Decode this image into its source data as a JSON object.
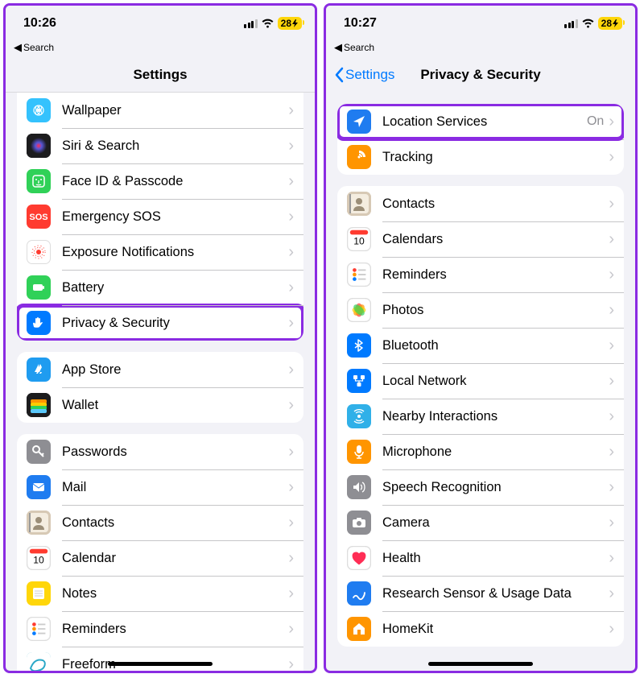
{
  "left": {
    "time": "10:26",
    "battery": "28",
    "breadcrumb": "Search",
    "title": "Settings",
    "groups": [
      {
        "first": true,
        "items": [
          {
            "icon": "wallpaper",
            "bg": "#34c2fd",
            "label": "Wallpaper"
          },
          {
            "icon": "siri",
            "bg": "#1c1c1e",
            "label": "Siri & Search"
          },
          {
            "icon": "faceid",
            "bg": "#30d158",
            "label": "Face ID & Passcode"
          },
          {
            "icon": "sos",
            "bg": "#ff3b30",
            "label": "Emergency SOS"
          },
          {
            "icon": "exposure",
            "bg": "#ffffff",
            "label": "Exposure Notifications"
          },
          {
            "icon": "battery",
            "bg": "#30d158",
            "label": "Battery"
          },
          {
            "icon": "hand",
            "bg": "#007aff",
            "label": "Privacy & Security",
            "highlight": true
          }
        ]
      },
      {
        "items": [
          {
            "icon": "appstore",
            "bg": "#1f9cf0",
            "label": "App Store"
          },
          {
            "icon": "wallet",
            "bg": "#1c1c1e",
            "label": "Wallet"
          }
        ]
      },
      {
        "items": [
          {
            "icon": "key",
            "bg": "#8e8e93",
            "label": "Passwords"
          },
          {
            "icon": "mail",
            "bg": "#1f7cf0",
            "label": "Mail"
          },
          {
            "icon": "contacts",
            "bg": "#d7c9b5",
            "label": "Contacts"
          },
          {
            "icon": "calendar",
            "bg": "#ffffff",
            "label": "Calendar"
          },
          {
            "icon": "notes",
            "bg": "#ffd60a",
            "label": "Notes"
          },
          {
            "icon": "reminders",
            "bg": "#ffffff",
            "label": "Reminders"
          },
          {
            "icon": "freeform",
            "bg": "#2aa8c7",
            "label": "Freeform"
          }
        ]
      }
    ]
  },
  "right": {
    "time": "10:27",
    "battery": "28",
    "breadcrumb": "Search",
    "back": "Settings",
    "title": "Privacy & Security",
    "groups": [
      {
        "items": [
          {
            "icon": "location",
            "bg": "#1f7cf0",
            "label": "Location Services",
            "detail": "On",
            "highlight": true
          },
          {
            "icon": "tracking",
            "bg": "#ff9500",
            "label": "Tracking"
          }
        ]
      },
      {
        "items": [
          {
            "icon": "contacts2",
            "bg": "#d7c9b5",
            "label": "Contacts"
          },
          {
            "icon": "calendars",
            "bg": "#ffffff",
            "label": "Calendars"
          },
          {
            "icon": "reminders2",
            "bg": "#ffffff",
            "label": "Reminders"
          },
          {
            "icon": "photos",
            "bg": "#ffffff",
            "label": "Photos"
          },
          {
            "icon": "bluetooth",
            "bg": "#007aff",
            "label": "Bluetooth"
          },
          {
            "icon": "localnet",
            "bg": "#007aff",
            "label": "Local Network"
          },
          {
            "icon": "nearby",
            "bg": "#30b0e8",
            "label": "Nearby Interactions"
          },
          {
            "icon": "microphone",
            "bg": "#ff9500",
            "label": "Microphone"
          },
          {
            "icon": "speech",
            "bg": "#8e8e93",
            "label": "Speech Recognition"
          },
          {
            "icon": "camera",
            "bg": "#8e8e93",
            "label": "Camera"
          },
          {
            "icon": "health",
            "bg": "#ffffff",
            "label": "Health"
          },
          {
            "icon": "research",
            "bg": "#1f7cf0",
            "label": "Research Sensor & Usage Data"
          },
          {
            "icon": "homekit",
            "bg": "#ff9500",
            "label": "HomeKit"
          }
        ]
      }
    ]
  }
}
